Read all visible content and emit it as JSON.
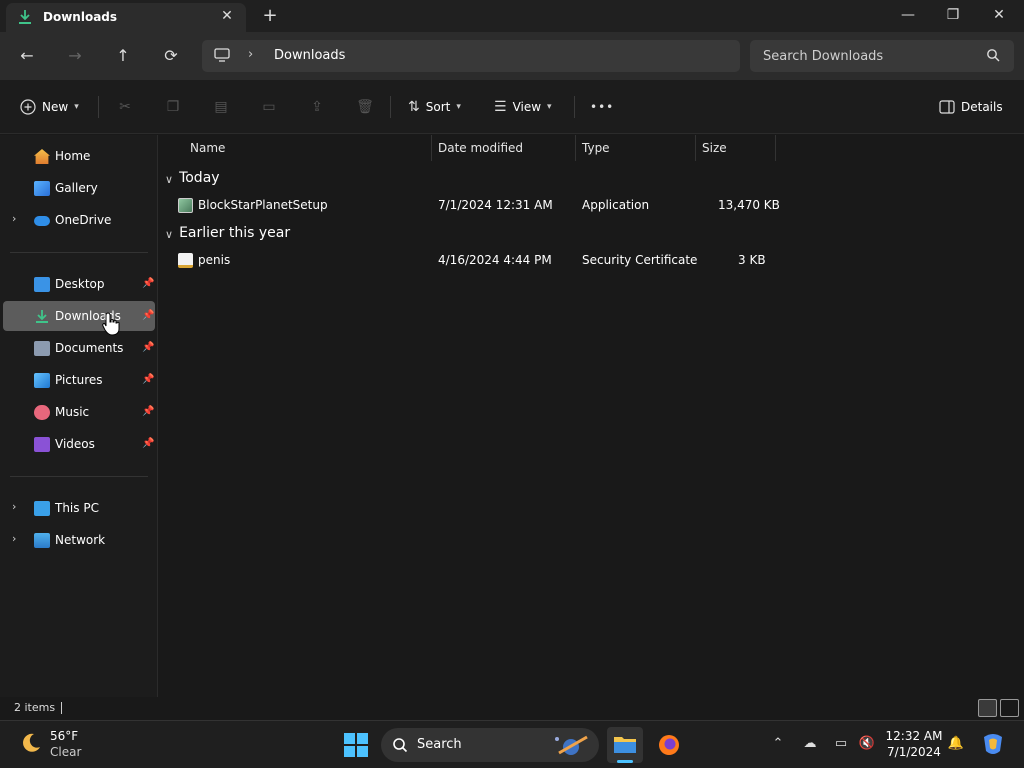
{
  "window": {
    "tab_title": "Downloads",
    "new_tab": "+",
    "minimize": "—",
    "maximize": "❐",
    "close": "✕"
  },
  "nav": {
    "back": "←",
    "forward": "→",
    "up": "↑",
    "refresh": "⟳",
    "breadcrumb": "Downloads",
    "search_placeholder": "Search Downloads"
  },
  "commands": {
    "new_label": "New",
    "sort_label": "Sort",
    "view_label": "View",
    "more": "•••",
    "details_label": "Details"
  },
  "sidebar": {
    "items": [
      {
        "label": "Home"
      },
      {
        "label": "Gallery"
      },
      {
        "label": "OneDrive"
      },
      {
        "label": "Desktop"
      },
      {
        "label": "Downloads"
      },
      {
        "label": "Documents"
      },
      {
        "label": "Pictures"
      },
      {
        "label": "Music"
      },
      {
        "label": "Videos"
      },
      {
        "label": "This PC"
      },
      {
        "label": "Network"
      }
    ]
  },
  "columns": {
    "name": "Name",
    "date": "Date modified",
    "type": "Type",
    "size": "Size"
  },
  "groups": [
    {
      "title": "Today",
      "files": [
        {
          "name": "BlockStarPlanetSetup",
          "date": "7/1/2024 12:31 AM",
          "type": "Application",
          "size": "13,470 KB"
        }
      ]
    },
    {
      "title": "Earlier this year",
      "files": [
        {
          "name": "penis",
          "date": "4/16/2024 4:44 PM",
          "type": "Security Certificate",
          "size": "3 KB"
        }
      ]
    }
  ],
  "status": {
    "count": "2 items"
  },
  "taskbar": {
    "temp": "56°F",
    "condition": "Clear",
    "search_label": "Search",
    "time": "12:32 AM",
    "date": "7/1/2024"
  },
  "colors": {
    "accent": "#4cc2ff",
    "selected": "#5c5c5c",
    "background": "#191919"
  }
}
